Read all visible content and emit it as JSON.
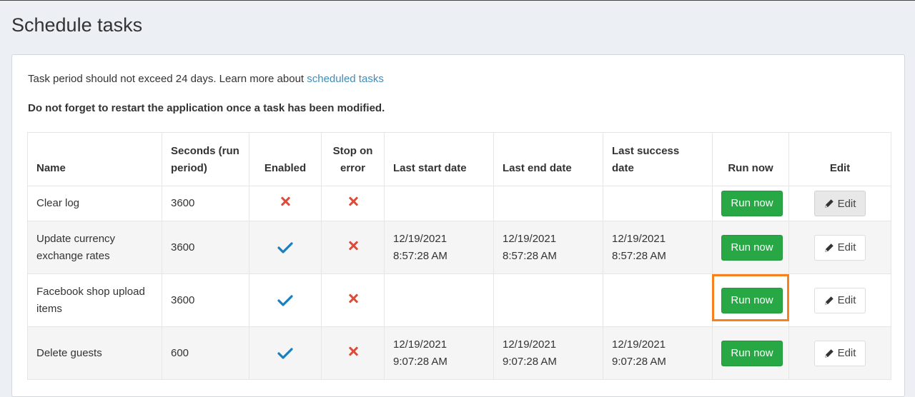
{
  "page": {
    "title": "Schedule tasks"
  },
  "info": {
    "text": "Task period should not exceed 24 days. Learn more about ",
    "link_text": "scheduled tasks"
  },
  "warning": {
    "text": "Do not forget to restart the application once a task has been modified."
  },
  "table": {
    "headers": {
      "name": "Name",
      "seconds": "Seconds (run period)",
      "enabled": "Enabled",
      "stop_on_error": "Stop on error",
      "last_start": "Last start date",
      "last_end": "Last end date",
      "last_success": "Last success date",
      "run_now": "Run now",
      "edit": "Edit"
    },
    "rows": [
      {
        "name": "Clear log",
        "seconds": "3600",
        "enabled": "x-icon",
        "stop_on_error": "x-icon",
        "last_start": "",
        "last_end": "",
        "last_success": "",
        "run_label": "Run now",
        "edit_label": "Edit"
      },
      {
        "name": "Update currency exchange rates",
        "seconds": "3600",
        "enabled": "check-icon",
        "stop_on_error": "x-icon",
        "last_start": "12/19/2021 8:57:28 AM",
        "last_end": "12/19/2021 8:57:28 AM",
        "last_success": "12/19/2021 8:57:28 AM",
        "run_label": "Run now",
        "edit_label": "Edit"
      },
      {
        "name": "Facebook shop upload items",
        "seconds": "3600",
        "enabled": "check-icon",
        "stop_on_error": "x-icon",
        "last_start": "",
        "last_end": "",
        "last_success": "",
        "run_label": "Run now",
        "edit_label": "Edit"
      },
      {
        "name": "Delete guests",
        "seconds": "600",
        "enabled": "check-icon",
        "stop_on_error": "x-icon",
        "last_start": "12/19/2021 9:07:28 AM",
        "last_end": "12/19/2021 9:07:28 AM",
        "last_success": "12/19/2021 9:07:28 AM",
        "run_label": "Run now",
        "edit_label": "Edit"
      }
    ]
  },
  "colors": {
    "success_green": "#28a745",
    "error_red": "#dd4b39",
    "check_blue": "#1a7fc1",
    "link_blue": "#3c8dbc",
    "highlight_orange": "#f5821f"
  }
}
